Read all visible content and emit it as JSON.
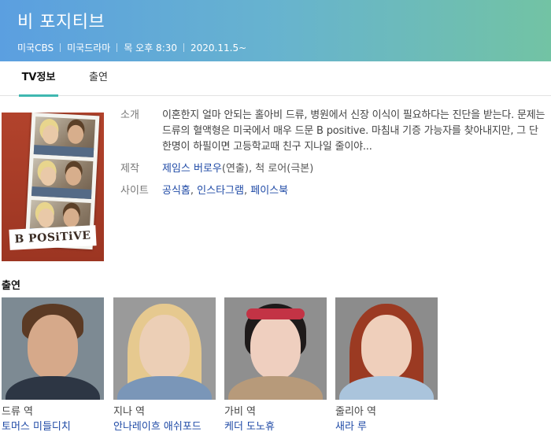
{
  "header": {
    "title": "비 포지티브",
    "meta": [
      "미국CBS",
      "미국드라마",
      "목 오후 8:30",
      "2020.11.5~"
    ]
  },
  "tabs": [
    {
      "label": "TV정보",
      "active": true
    },
    {
      "label": "출연",
      "active": false
    }
  ],
  "poster": {
    "logo_text": "B POSiTiVE"
  },
  "info": {
    "intro_label": "소개",
    "intro_text": "이혼한지 얼마 안되는 홀아비 드류, 병원에서 신장 이식이 필요하다는 진단을 받는다. 문제는 드류의 혈액형은 미국에서 매우 드문 B positive. 마침내 기증 가능자를 찾아내지만, 그 단 한명이 하필이면 고등학교때 친구 지나일 줄이야...",
    "production_label": "제작",
    "production_director": "제임스 버로우",
    "production_director_role": "(연출),",
    "production_writer": "척 로어",
    "production_writer_role": "(극본)",
    "site_label": "사이트",
    "sites": [
      "공식홈",
      "인스타그램",
      "페이스북"
    ]
  },
  "cast_title": "출연",
  "cast": [
    {
      "role": "드류 역",
      "actor": "토머스 미들디치"
    },
    {
      "role": "지나 역",
      "actor": "안나레이흐 애쉬포드"
    },
    {
      "role": "가비 역",
      "actor": "케더 도노휴"
    },
    {
      "role": "줄리아 역",
      "actor": "새라 루"
    }
  ],
  "colors": {
    "header_gradient_start": "#5b9fe0",
    "header_gradient_end": "#72c3a4",
    "tab_underline": "#3fb8b0",
    "link": "#1f4aa6"
  }
}
